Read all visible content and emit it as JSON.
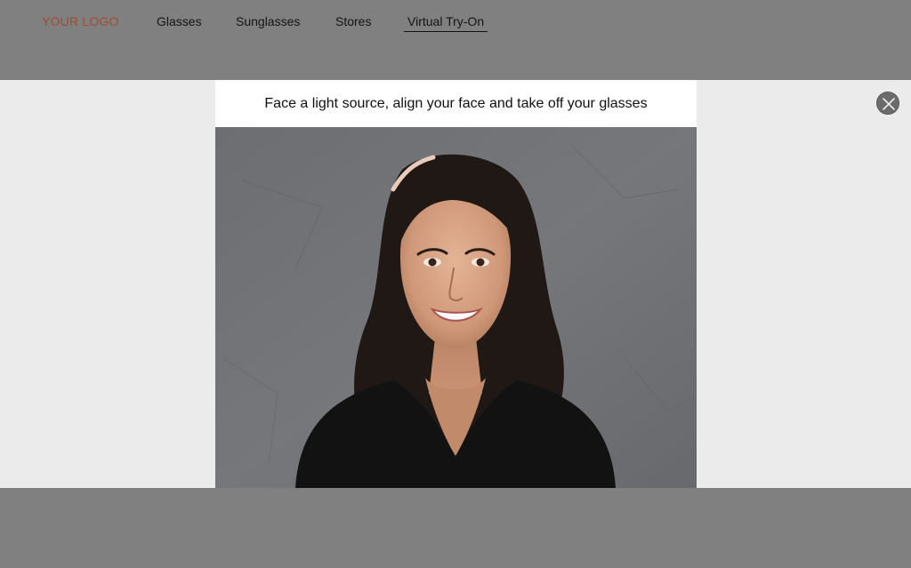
{
  "header": {
    "logo": "YOUR LOGO",
    "nav": [
      {
        "label": "Glasses"
      },
      {
        "label": "Sunglasses"
      },
      {
        "label": "Stores"
      },
      {
        "label": "Virtual Try-On",
        "active": true
      }
    ]
  },
  "modal": {
    "instruction": "Face a light source, align your face and take off your glasses",
    "camera_preview": "webcam feed of a smiling woman with long dark hair",
    "close_icon": "close-icon"
  },
  "colors": {
    "logo": "#a34a31",
    "overlay": "#ebebeb",
    "backdrop": "#808080",
    "close_button": "#6b6b6b"
  }
}
